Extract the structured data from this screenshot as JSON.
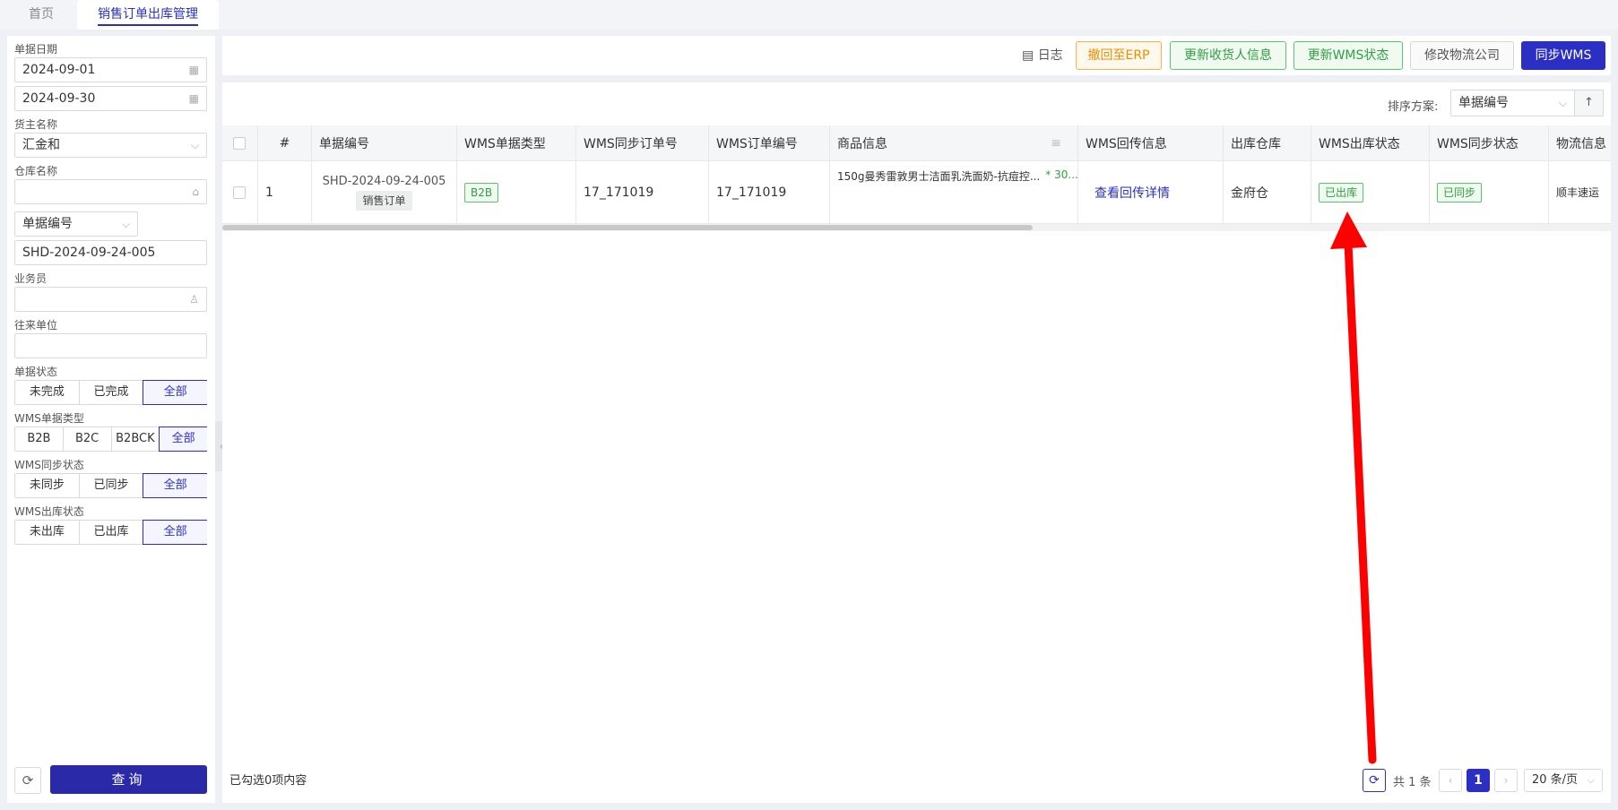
{
  "tabs": {
    "home": "首页",
    "active": "销售订单出库管理"
  },
  "filters": {
    "date_label": "单据日期",
    "date_from": "2024-09-01",
    "date_to": "2024-09-30",
    "owner_label": "货主名称",
    "owner_value": "汇金和",
    "warehouse_label": "仓库名称",
    "warehouse_value": "",
    "doc_field_select": "单据编号",
    "doc_no_value": "SHD-2024-09-24-005",
    "salesman_label": "业务员",
    "salesman_value": "",
    "partner_label": "往来单位",
    "partner_value": "",
    "status_label": "单据状态",
    "status_options": [
      "未完成",
      "已完成",
      "全部"
    ],
    "wms_type_label": "WMS单据类型",
    "wms_type_options": [
      "B2B",
      "B2C",
      "B2BCK",
      "全部"
    ],
    "wms_sync_label": "WMS同步状态",
    "wms_sync_options": [
      "未同步",
      "已同步",
      "全部"
    ],
    "wms_out_label": "WMS出库状态",
    "wms_out_options": [
      "未出库",
      "已出库",
      "全部"
    ],
    "query_label": "查询"
  },
  "toolbar": {
    "log_label": "日志",
    "revoke_erp": "撤回至ERP",
    "update_receiver": "更新收货人信息",
    "update_wms_status": "更新WMS状态",
    "modify_logistics": "修改物流公司",
    "sync_wms": "同步WMS"
  },
  "sort": {
    "label": "排序方案:",
    "value": "单据编号"
  },
  "table": {
    "columns": [
      "#",
      "单据编号",
      "WMS单据类型",
      "WMS同步订单号",
      "WMS订单编号",
      "商品信息",
      "WMS回传信息",
      "出库仓库",
      "WMS出库状态",
      "WMS同步状态",
      "物流信息"
    ],
    "rows": [
      {
        "index": "1",
        "doc_no": "SHD-2024-09-24-005",
        "doc_type": "销售订单",
        "wms_type": "B2B",
        "wms_sync_no": "17_171019",
        "wms_order_no": "17_171019",
        "product": "150g曼秀雷敦男士洁面乳洗面奶-抗痘控...",
        "product_qty": "* 30...",
        "callback": "查看回传详情",
        "warehouse": "金府仓",
        "out_status": "已出库",
        "sync_status": "已同步",
        "logistics": "顺丰速运"
      }
    ]
  },
  "footer": {
    "selected": "已勾选0项内容",
    "total": "共 1 条",
    "page": "1",
    "page_size": "20 条/页"
  },
  "colors": {
    "accent": "#2c2fc4",
    "green": "#2f9f3f",
    "orange": "#e98e00",
    "arrow": "#ff0000"
  }
}
